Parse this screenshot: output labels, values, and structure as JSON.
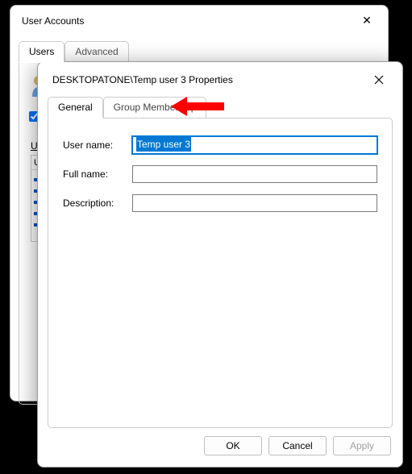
{
  "bg": {
    "title": "User Accounts",
    "tabs": {
      "users": "Users",
      "advanced": "Advanced"
    },
    "listHeader": "U",
    "underlineLabel": "Us"
  },
  "fw": {
    "title": "DESKTOPATONE\\Temp user 3 Properties",
    "tabs": {
      "general": "General",
      "group": "Group Membership"
    },
    "labels": {
      "username": "User name:",
      "fullname": "Full name:",
      "description": "Description:"
    },
    "fields": {
      "username": "Temp user 3",
      "fullname": "",
      "description": ""
    },
    "buttons": {
      "ok": "OK",
      "cancel": "Cancel",
      "apply": "Apply"
    }
  }
}
